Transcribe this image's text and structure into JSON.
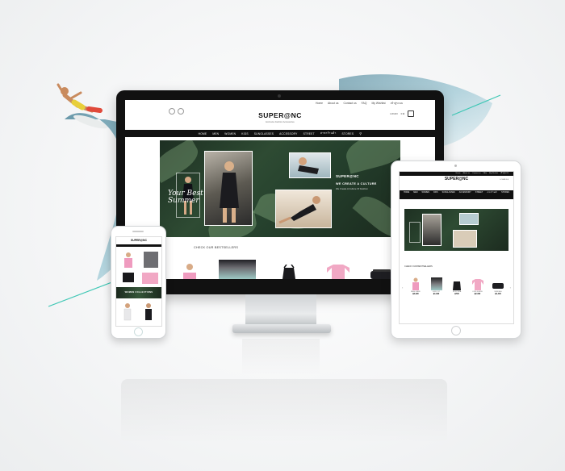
{
  "colors": {
    "nav": "#111111",
    "jungle": "#2e4b33",
    "accent_line": "#3fc7b5",
    "pink": "#ef9bbf"
  },
  "icons": [
    "facebook-icon",
    "instagram-icon",
    "search-icon",
    "cart-icon",
    "chevron-left-icon",
    "chevron-right-icon"
  ],
  "desktop": {
    "topbar": [
      "Home",
      "About us",
      "Contact us",
      "FAQ",
      "My Wishlist",
      "เข้าสู่ระบบ"
    ],
    "brand": "SUPER@NC",
    "tagline": "Exclusive Fashion Accessories",
    "cart": {
      "login": "LOGIN",
      "price": "0 ฿",
      "count": "0"
    },
    "nav": [
      "HOME",
      "MEN",
      "WOMEN",
      "KIDS",
      "SUNGLASSES",
      "ACCESSORY",
      "STREET",
      "สาขาร้านค้า",
      "STORES"
    ],
    "hero": {
      "script_title": "Your Best Summer",
      "headline_1": "SUPER@NC",
      "headline_2": "WE CREATE A CULTURE",
      "sub": "We Create A Culture Of Fashion"
    },
    "bestsellers_title": "CHECK OUR BESTSELLERS"
  },
  "tablet": {
    "topbar": [
      "Home",
      "About us",
      "Contact us",
      "FAQ",
      "My Wishlist",
      "เข้าสู่ระบบ"
    ],
    "brand": "SUPER@NC",
    "cart": "LOGIN  0 ฿",
    "nav": [
      "HOME",
      "MEN",
      "WOMEN",
      "KIDS",
      "SUNGLASSES",
      "ACCESSORY",
      "STREET",
      "สาขาร้านค้า",
      "STORES"
    ],
    "bestsellers_title": "CHECK OUR BESTSELLERS",
    "products": [
      {
        "name": "RASH GUARD",
        "price": "฿2,990"
      },
      {
        "name": "SURF TOP",
        "price": "฿1,690"
      },
      {
        "name": "SPORT BRA",
        "price": "฿790"
      },
      {
        "name": "LONG SLEEVE",
        "price": "฿2,390"
      },
      {
        "name": "SWIM BAG",
        "price": "฿1,490"
      }
    ]
  },
  "phone": {
    "brand": "SUPER@NC",
    "banner": "WOMEN COLLECTIONS"
  }
}
